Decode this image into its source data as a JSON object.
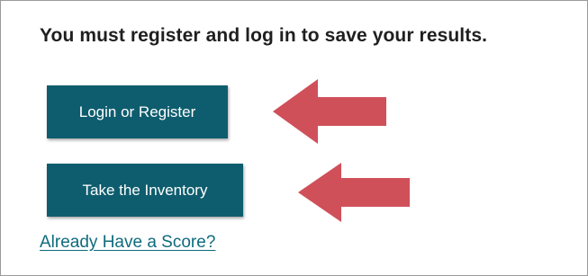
{
  "prompt": {
    "heading": "You must register and log in to save your results."
  },
  "actions": {
    "login_register_label": "Login or Register",
    "take_inventory_label": "Take the Inventory",
    "already_have_score_label": "Already Have a Score?"
  },
  "annotations": {
    "arrow_color": "#d0505a",
    "arrow_icon": "arrow-left-icon"
  },
  "colors": {
    "button_bg": "#0e5d6e",
    "link": "#0e6b7c"
  }
}
